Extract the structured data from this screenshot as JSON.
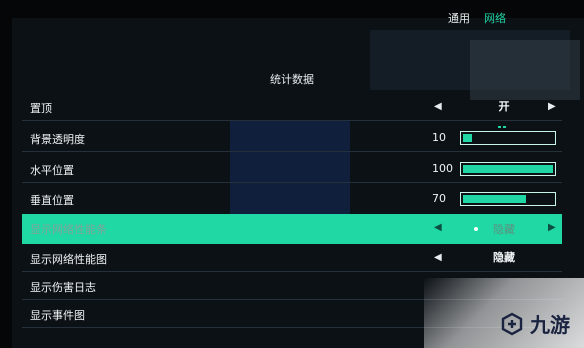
{
  "tabs": [
    {
      "label": "通用",
      "active": false
    },
    {
      "label": "网络",
      "active": true
    }
  ],
  "section_title": "统计数据",
  "rows": [
    {
      "label": "置顶",
      "type": "toggle",
      "value": "开"
    },
    {
      "label": "背景透明度",
      "type": "slider",
      "value": "10",
      "fraction": 0.1
    },
    {
      "label": "水平位置",
      "type": "slider",
      "value": "100",
      "fraction": 1.0
    },
    {
      "label": "垂直位置",
      "type": "slider",
      "value": "70",
      "fraction": 0.7
    },
    {
      "label": "显示网络性能条",
      "type": "toggle",
      "value": "隐藏",
      "highlighted": true
    },
    {
      "label": "显示网络性能图",
      "type": "toggle",
      "value": "隐藏"
    },
    {
      "label": "显示伤害日志",
      "type": "toggle",
      "value": ""
    },
    {
      "label": "显示事件图",
      "type": "toggle",
      "value": ""
    }
  ],
  "watermark": {
    "text": "九游"
  },
  "colors": {
    "accent": "#20d6a4",
    "background": "#0c1116",
    "highlight": "#1fd8a4"
  }
}
